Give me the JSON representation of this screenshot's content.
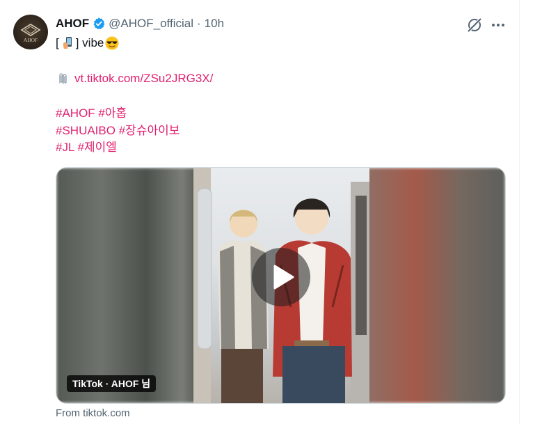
{
  "tweet": {
    "author": {
      "name": "AHOF",
      "handle": "@AHOF_official",
      "avatar_text": "AHOF",
      "verified": true
    },
    "separator": "·",
    "time": "10h",
    "text": {
      "open_bracket": "[",
      "after_phone": "] vibe",
      "link": "vt.tiktok.com/ZSu2JRG3X/",
      "hashtags": [
        [
          "#AHOF",
          "#아홉"
        ],
        [
          "#SHUAIBO",
          "#장슈아이보"
        ],
        [
          "#JL",
          "#제이엘"
        ]
      ]
    },
    "media": {
      "overlay_label": "TikTok · AHOF 님"
    },
    "source": "From tiktok.com"
  },
  "icons": {
    "verified": "verified-badge-icon",
    "grok": "grok-icon",
    "more": "more-options-icon",
    "play": "play-icon",
    "phone": "selfie-phone-emoji",
    "cool": "sunglasses-emoji",
    "clip": "paperclip-emoji"
  },
  "colors": {
    "hashtag_link": "#e0206f",
    "verified_blue": "#1d9bf0",
    "secondary_text": "#536471",
    "primary_text": "#0f1419"
  }
}
